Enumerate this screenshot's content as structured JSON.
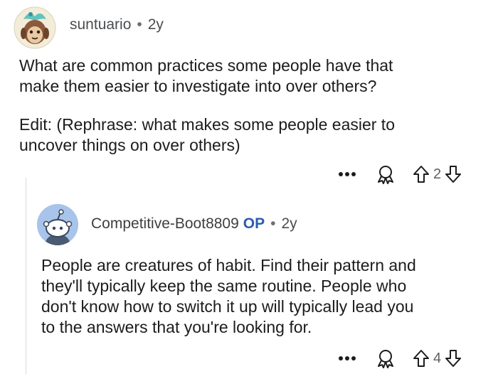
{
  "comments": [
    {
      "username": "suntuario",
      "separator": "•",
      "age": "2y",
      "paragraphs": [
        [
          "What are common practices some people have that",
          "make them easier to investigate into over others?"
        ],
        [
          "Edit: (Rephrase: what makes some people easier to",
          "uncover things on over others)"
        ]
      ],
      "vote_count": "2"
    },
    {
      "username": "Competitive-Boot8809",
      "op_badge": "OP",
      "separator": "•",
      "age": "2y",
      "paragraphs": [
        [
          "People are creatures of habit. Find their pattern and",
          "they'll typically keep the same routine. People who",
          "don't know how to switch it up will typically lead you",
          "to the answers that you're looking for."
        ]
      ],
      "vote_count": "4"
    }
  ],
  "icons": {
    "more": "more-options-icon",
    "award": "award-icon",
    "upvote": "upvote-arrow-icon",
    "downvote": "downvote-arrow-icon"
  },
  "colors": {
    "op_badge": "#2a5db0",
    "avatar2_bg": "#a9c4ea",
    "thread_line": "#d9dadb"
  }
}
